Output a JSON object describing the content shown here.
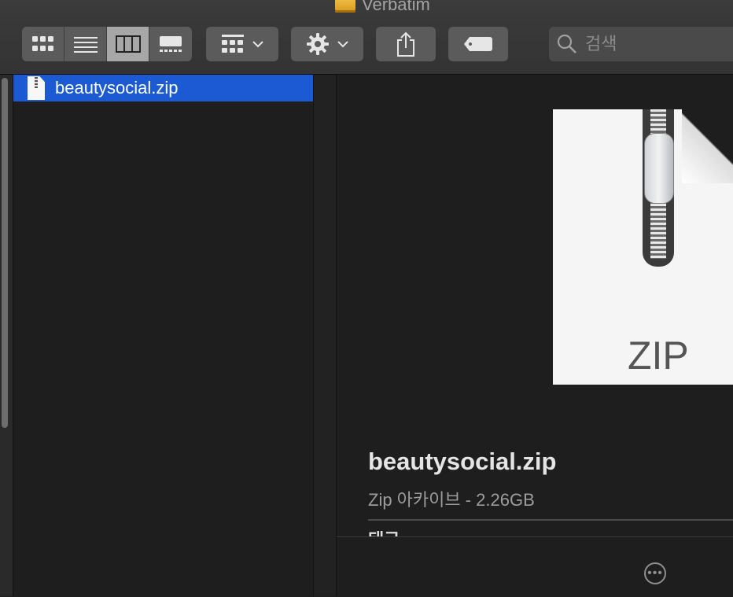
{
  "window": {
    "title": "Verbatim",
    "drive_icon": "external-drive-icon"
  },
  "toolbar": {
    "view_modes": [
      {
        "icon": "icon-view-icon",
        "active": false
      },
      {
        "icon": "list-view-icon",
        "active": false
      },
      {
        "icon": "column-view-icon",
        "active": true
      },
      {
        "icon": "gallery-view-icon",
        "active": false
      }
    ],
    "group_button_icon": "group-grid-icon",
    "action_button_icon": "gear-icon",
    "share_icon": "share-icon",
    "tag_icon": "tag-icon",
    "search": {
      "placeholder": "검색",
      "value": ""
    }
  },
  "files": [
    {
      "name": "beautysocial.zip",
      "selected": true,
      "icon": "zip-file-icon"
    }
  ],
  "preview": {
    "icon_text": "ZIP",
    "name": "beautysocial.zip",
    "kind_size": "Zip 아카이브 - 2.26GB",
    "tags_label": "태그",
    "more_icon": "more-icon"
  },
  "colors": {
    "selection": "#1b5ad2",
    "background": "#1e1e1f",
    "toolbar": "#3b3b3b"
  }
}
